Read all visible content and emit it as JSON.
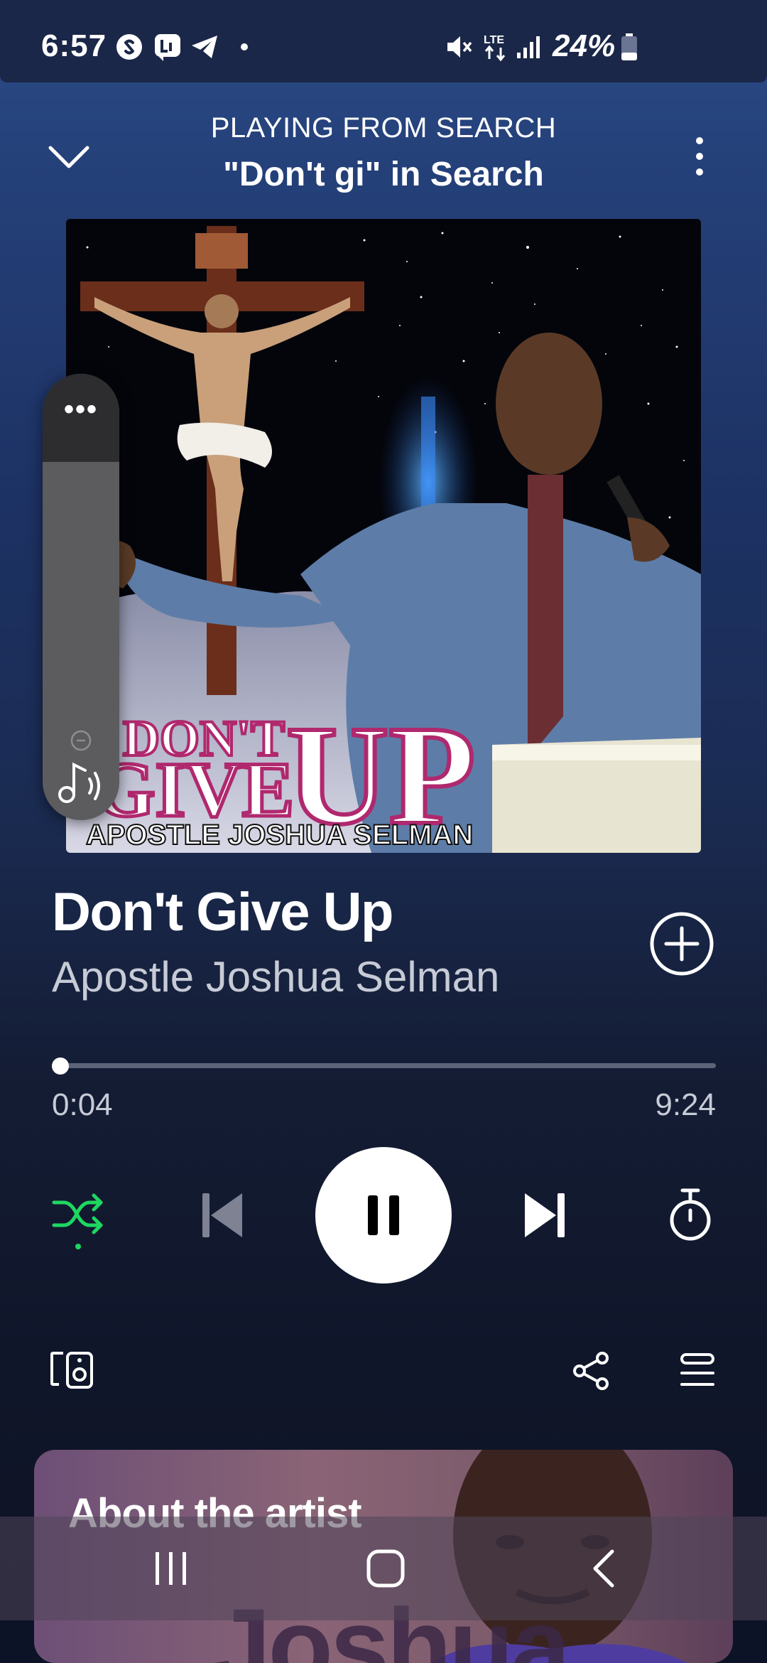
{
  "status_bar": {
    "time": "6:57",
    "battery": "24%",
    "icons": [
      "shazam-icon",
      "ladder-app-icon",
      "telegram-icon",
      "dot-icon",
      "mute-icon",
      "lte-icon",
      "signal-icon",
      "battery-icon"
    ]
  },
  "header": {
    "context": "PLAYING FROM SEARCH",
    "source": "\"Don't gi\" in Search"
  },
  "album_art": {
    "text_line1": "DON'T",
    "text_line2": "GIVE",
    "text_big": "UP",
    "text_name": "APOSTLE JOSHUA SELMAN"
  },
  "track": {
    "title": "Don't Give Up",
    "artist": "Apostle Joshua Selman",
    "elapsed": "0:04",
    "duration": "9:24",
    "progress": 0.007
  },
  "controls": {
    "shuffle_active": true,
    "accent": "#1ed760"
  },
  "about": {
    "title": "About the artist",
    "bg_text": "Joshua"
  },
  "colors": {
    "background_top": "#2b4b88",
    "background_bottom": "#0e1324",
    "accent_green": "#1ed760"
  }
}
